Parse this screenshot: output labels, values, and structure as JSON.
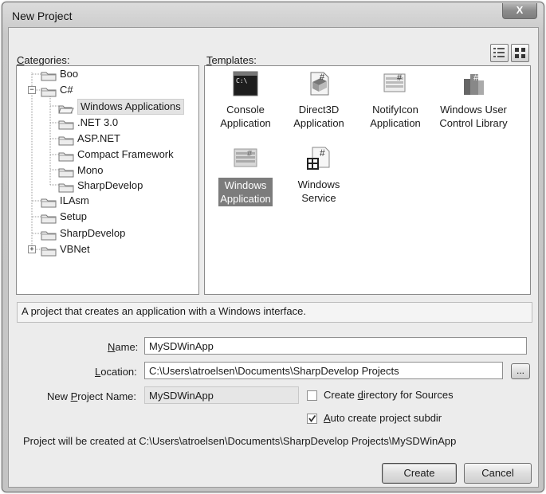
{
  "window": {
    "title": "New Project",
    "close_glyph": "X"
  },
  "categories": {
    "label": "Categories:",
    "tree": [
      {
        "label": "Boo"
      },
      {
        "label": "C#",
        "expander": "−"
      },
      {
        "label": "Windows Applications"
      },
      {
        "label": ".NET 3.0"
      },
      {
        "label": "ASP.NET"
      },
      {
        "label": "Compact Framework"
      },
      {
        "label": "Mono"
      },
      {
        "label": "SharpDevelop"
      },
      {
        "label": "ILAsm"
      },
      {
        "label": "Setup"
      },
      {
        "label": "SharpDevelop"
      },
      {
        "label": "VBNet",
        "expander": "+"
      }
    ],
    "selected_index": 2
  },
  "templates": {
    "label": "Templates:",
    "items": [
      {
        "line1": "Console",
        "line2": "Application",
        "icon": "console-app-icon"
      },
      {
        "line1": "Direct3D",
        "line2": "Application",
        "icon": "direct3d-app-icon"
      },
      {
        "line1": "NotifyIcon",
        "line2": "Application",
        "icon": "notifyicon-app-icon"
      },
      {
        "line1": "Windows User",
        "line2": "Control Library",
        "icon": "user-control-library-icon"
      },
      {
        "line1": "Windows",
        "line2": "Application",
        "icon": "windows-app-icon"
      },
      {
        "line1": "Windows",
        "line2": "Service",
        "icon": "windows-service-icon"
      }
    ],
    "selected_index": 4
  },
  "description": "A project that creates an application with a Windows interface.",
  "form": {
    "name_label": "Name:",
    "name_value": "MySDWinApp",
    "location_label": "Location:",
    "location_value": "C:\\Users\\atroelsen\\Documents\\SharpDevelop Projects",
    "browse_label": "...",
    "new_project_name_label": "New Project Name:",
    "new_project_name_value": "MySDWinApp",
    "create_dir_label": "Create directory for Sources",
    "create_dir_checked": false,
    "auto_subdir_label": "Auto create project subdir",
    "auto_subdir_checked": true
  },
  "path_info": "Project will be created at C:\\Users\\atroelsen\\Documents\\SharpDevelop Projects\\MySDWinApp",
  "buttons": {
    "create": "Create",
    "cancel": "Cancel"
  }
}
